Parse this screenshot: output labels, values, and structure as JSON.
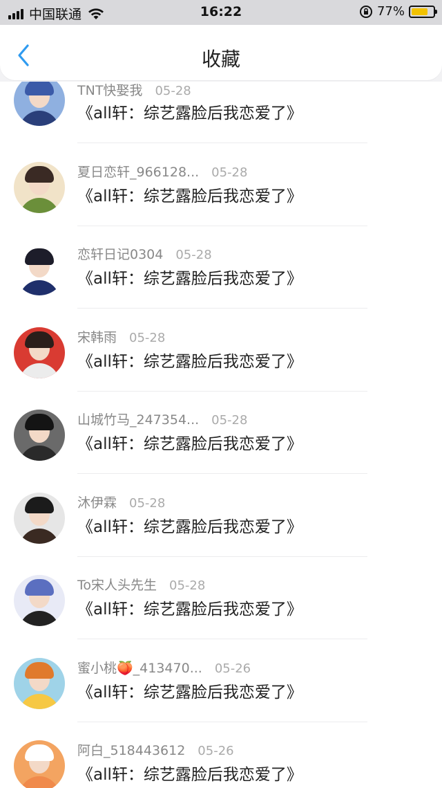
{
  "status_bar": {
    "carrier": "中国联通",
    "time": "16:22",
    "battery_percent": "77%",
    "battery_level": 0.77,
    "battery_color": "#f2c200"
  },
  "nav": {
    "title": "收藏",
    "back_icon": "chevron-left-icon",
    "accent_color": "#2f9bf0"
  },
  "items": [
    {
      "author": "TNT快娶我",
      "date": "05-28",
      "title": "《all轩：综艺露脸后我恋爱了》",
      "avatar_colors": [
        "#3b5aa8",
        "#8fb0e0",
        "#2a3f7a"
      ]
    },
    {
      "author": "夏日恋轩_966128...",
      "date": "05-28",
      "title": "《all轩：综艺露脸后我恋爱了》",
      "avatar_colors": [
        "#3a2a24",
        "#f1e3c8",
        "#6b8f3a"
      ]
    },
    {
      "author": "恋轩日记0304",
      "date": "05-28",
      "title": "《all轩：综艺露脸后我恋爱了》",
      "avatar_colors": [
        "#1d1d2a",
        "#ffffff",
        "#1f2f6b"
      ]
    },
    {
      "author": "宋韩雨",
      "date": "05-28",
      "title": "《all轩：综艺露脸后我恋爱了》",
      "avatar_colors": [
        "#2b1e1a",
        "#d93b32",
        "#ececec"
      ]
    },
    {
      "author": "山城竹马_247354...",
      "date": "05-28",
      "title": "《all轩：综艺露脸后我恋爱了》",
      "avatar_colors": [
        "#141414",
        "#6a6a6a",
        "#2a2a2a"
      ]
    },
    {
      "author": "沐伊霖",
      "date": "05-28",
      "title": "《all轩：综艺露脸后我恋爱了》",
      "avatar_colors": [
        "#1b1b1b",
        "#e6e6e6",
        "#3a2a22"
      ]
    },
    {
      "author": "To宋人头先生",
      "date": "05-28",
      "title": "《all轩：综艺露脸后我恋爱了》",
      "avatar_colors": [
        "#5b6fc0",
        "#e8eaf6",
        "#222222"
      ]
    },
    {
      "author": "蜜小桃🍑_413470...",
      "date": "05-26",
      "title": "《all轩：综艺露脸后我恋爱了》",
      "avatar_colors": [
        "#e07a2c",
        "#9fd3e8",
        "#f6c844"
      ]
    },
    {
      "author": "阿白_518443612",
      "date": "05-26",
      "title": "《all轩：综艺露脸后我恋爱了》",
      "avatar_colors": [
        "#ffffff",
        "#f3a461",
        "#f08a4b"
      ]
    }
  ]
}
